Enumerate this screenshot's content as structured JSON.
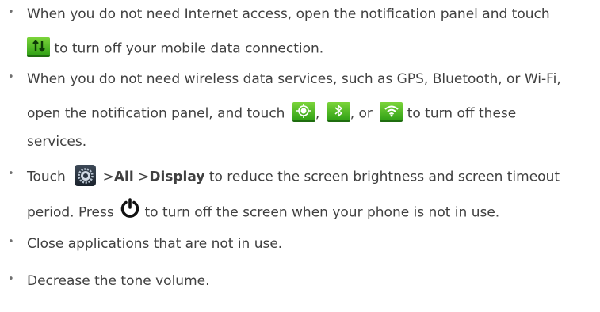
{
  "bullet_char": "•",
  "items": [
    {
      "l1": "When you do not need Internet access, open the notification panel and touch",
      "l2": "to turn off your mobile data connection."
    },
    {
      "l1": "When you do not need wireless data services, such as GPS, Bluetooth, or Wi-Fi,",
      "l2a": "open the notification panel, and touch",
      "l2b": ",",
      "l2c": ", or",
      "l2d": "to turn off these",
      "l3": "services."
    },
    {
      "l1a": "Touch",
      "sep1": ">",
      "all": "All",
      "sep2": ">",
      "display": "Display",
      "l1b": "to reduce the screen brightness and screen timeout",
      "l2a": "period. Press",
      "l2b": "to turn off the screen when your phone is not in use."
    },
    {
      "l1": "Close applications that are not in use."
    },
    {
      "l1": "Decrease the tone volume."
    }
  ],
  "icons": {
    "data": "mobile-data-icon",
    "gps": "gps-icon",
    "bluetooth": "bluetooth-icon",
    "wifi": "wifi-icon",
    "settings": "settings-icon",
    "power": "power-icon"
  },
  "colors": {
    "icon_green": "#4cb82a",
    "text": "#404040"
  }
}
